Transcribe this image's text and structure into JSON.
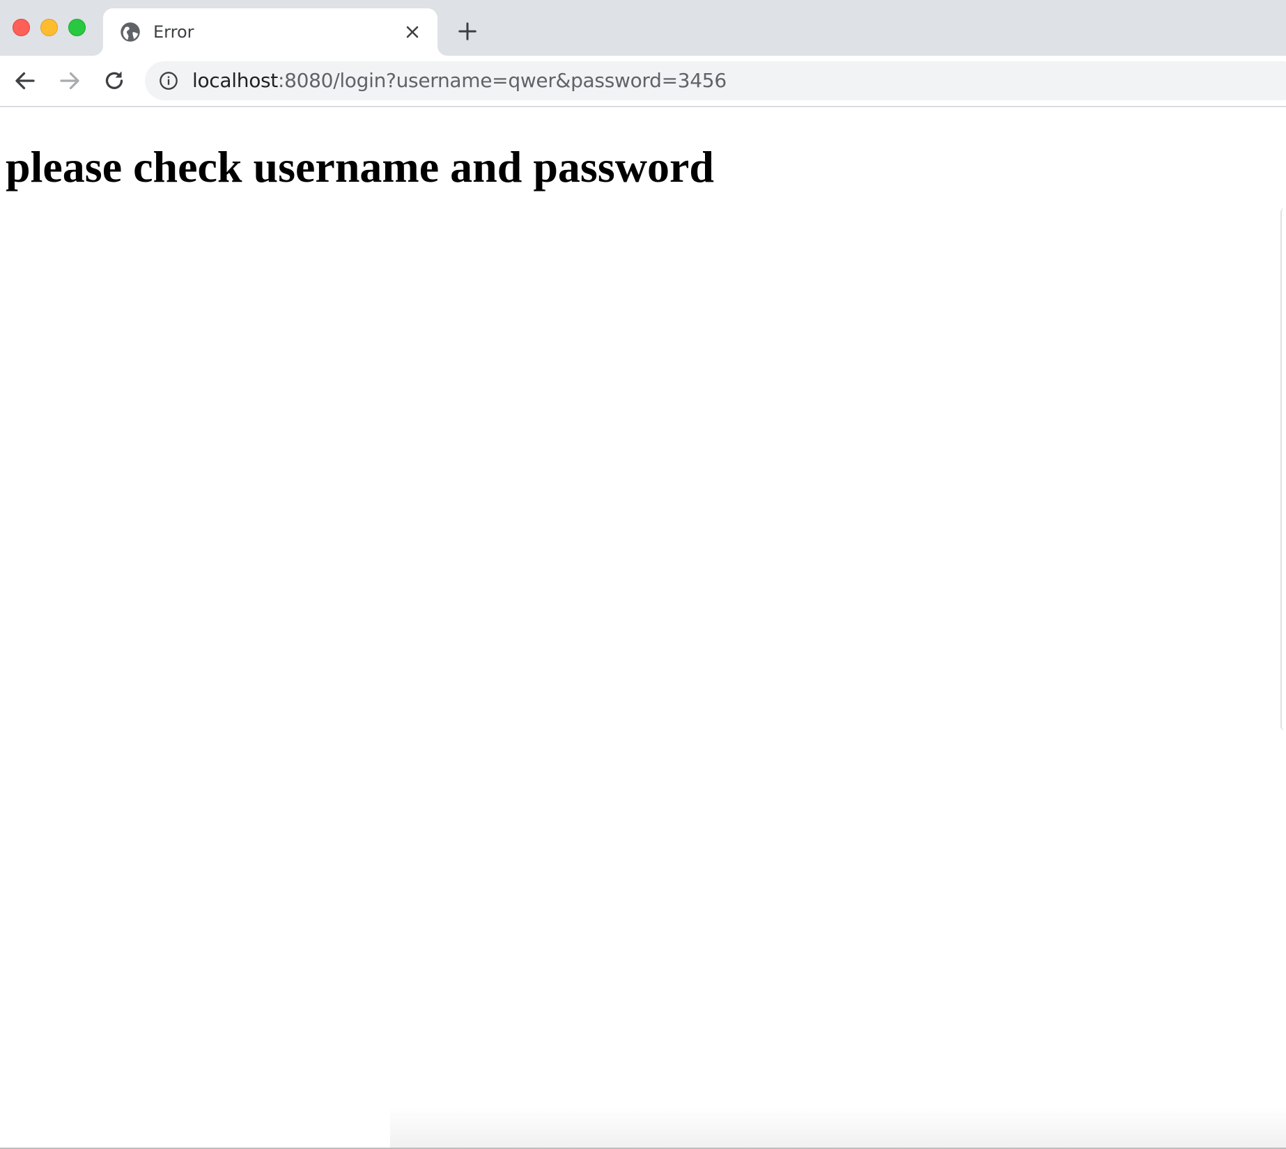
{
  "window": {
    "controls": [
      "close",
      "minimize",
      "zoom"
    ]
  },
  "tab": {
    "title": "Error",
    "favicon": "globe-icon",
    "close_icon": "close-icon"
  },
  "new_tab_icon": "plus-icon",
  "toolbar": {
    "back_icon": "arrow-left-icon",
    "forward_icon": "arrow-right-icon",
    "reload_icon": "reload-icon",
    "site_info_icon": "info-icon"
  },
  "address_bar": {
    "host": "localhost",
    "rest": ":8080/login?username=qwer&password=3456"
  },
  "page": {
    "heading": "please check username and password"
  },
  "colors": {
    "tabstrip": "#dee1e6",
    "omnibox": "#f1f3f4",
    "close": "#fe5f57",
    "minimize": "#febc2e",
    "zoom": "#28c840"
  }
}
